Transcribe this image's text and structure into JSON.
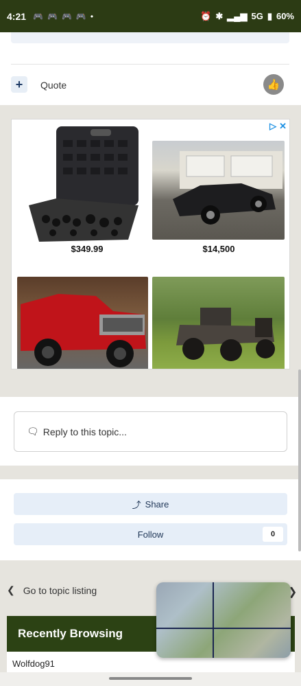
{
  "status_bar": {
    "time": "4:21",
    "app_icons": [
      "game-controller-icon",
      "game-controller-icon",
      "game-controller-icon",
      "game-controller-icon"
    ],
    "dot": "•",
    "network": "5G",
    "battery": "60%"
  },
  "post": {
    "quote_label": "Quote",
    "plus_symbol": "+"
  },
  "ad": {
    "products": [
      {
        "name": "tool-case",
        "price": "$349.99"
      },
      {
        "name": "black-muscle-car",
        "price": "$14,500"
      },
      {
        "name": "red-ford-truck",
        "price": ""
      },
      {
        "name": "old-rat-rod-truck",
        "price": ""
      }
    ]
  },
  "reply": {
    "placeholder": "Reply to this topic..."
  },
  "actions": {
    "share_label": "Share",
    "follow_label": "Follow",
    "follow_count": "0"
  },
  "navigation": {
    "go_to_listing": "Go to topic listing"
  },
  "recently_browsing": {
    "title": "Recently Browsing",
    "users": [
      "Wolfdog91"
    ]
  },
  "colors": {
    "header_green": "#2c3b14",
    "button_blue_bg": "#e6eef8",
    "page_bg": "#e6e4de"
  }
}
